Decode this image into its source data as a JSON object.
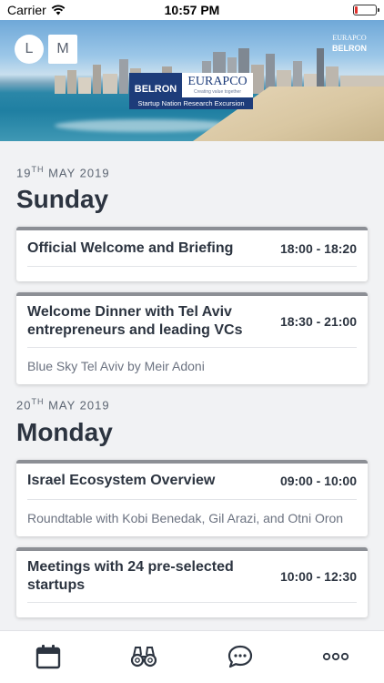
{
  "status_bar": {
    "carrier": "Carrier",
    "time": "10:57 PM",
    "battery_level": 0.12,
    "battery_color": "#e0302b"
  },
  "banner": {
    "avatar_l": "L",
    "avatar_m": "M",
    "corner_logo": {
      "top": "EURAPCO",
      "bottom": "BELRON"
    },
    "center_logo": {
      "belron": "BELRON",
      "eurapco": "EURAPCO",
      "tagline": "Creating value together",
      "strip": "Startup Nation Research Excursion"
    }
  },
  "days": [
    {
      "date_day": "19",
      "date_suffix": "TH",
      "date_rest": " MAY 2019",
      "name": "Sunday",
      "events": [
        {
          "title": "Official Welcome and Briefing",
          "time": "18:00 - 18:20",
          "subtitle": ""
        },
        {
          "title": "Welcome Dinner with Tel Aviv entrepreneurs and leading VCs",
          "time": "18:30 - 21:00",
          "subtitle": "Blue Sky Tel Aviv by Meir Adoni"
        }
      ]
    },
    {
      "date_day": "20",
      "date_suffix": "TH",
      "date_rest": " MAY 2019",
      "name": "Monday",
      "events": [
        {
          "title": "Israel Ecosystem Overview",
          "time": "09:00 - 10:00",
          "subtitle": "Roundtable with Kobi Benedak, Gil Arazi, and Otni Oron"
        },
        {
          "title": "Meetings with 24 pre-selected startups",
          "time": "10:00 - 12:30",
          "subtitle": ""
        }
      ]
    }
  ],
  "tab_bar": {
    "icons": [
      "calendar-icon",
      "binoculars-icon",
      "chat-icon",
      "more-icon"
    ],
    "active_color": "#2c3440"
  },
  "colors": {
    "card_top_border": "#8c8f95",
    "text_dark": "#2c3440",
    "text_muted": "#6b7280",
    "background": "#f1f2f4"
  }
}
